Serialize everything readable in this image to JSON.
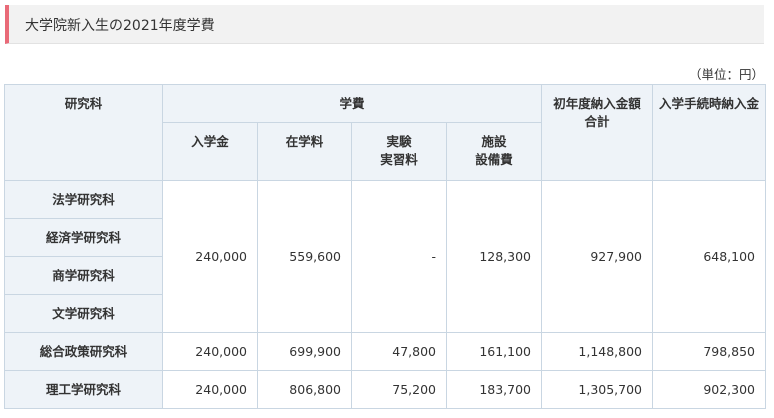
{
  "title": "大学院新入生の2021年度学費",
  "unit": "（単位：円）",
  "headers": {
    "department": "研究科",
    "fees": "学費",
    "admission": "入学金",
    "tuition": "在学料",
    "lab_line1": "実験",
    "lab_line2": "実習料",
    "facility_line1": "施設",
    "facility_line2": "設備費",
    "first_year_line1": "初年度納入金額",
    "first_year_line2": "合計",
    "at_enrollment": "入学手続時納入金"
  },
  "group": {
    "departments": [
      "法学研究科",
      "経済学研究科",
      "商学研究科",
      "文学研究科"
    ],
    "admission": "240,000",
    "tuition": "559,600",
    "lab": "-",
    "facility": "128,300",
    "first_year": "927,900",
    "at_enrollment": "648,100"
  },
  "rows": [
    {
      "department": "総合政策研究科",
      "admission": "240,000",
      "tuition": "699,900",
      "lab": "47,800",
      "facility": "161,100",
      "first_year": "1,148,800",
      "at_enrollment": "798,850"
    },
    {
      "department": "理工学研究科",
      "admission": "240,000",
      "tuition": "806,800",
      "lab": "75,200",
      "facility": "183,700",
      "first_year": "1,305,700",
      "at_enrollment": "902,300"
    }
  ],
  "colors": {
    "accent_bar": "#e96a78",
    "header_bg": "#eef3f8",
    "border": "#c9d6e2",
    "title_bg": "#f2f2f2"
  }
}
